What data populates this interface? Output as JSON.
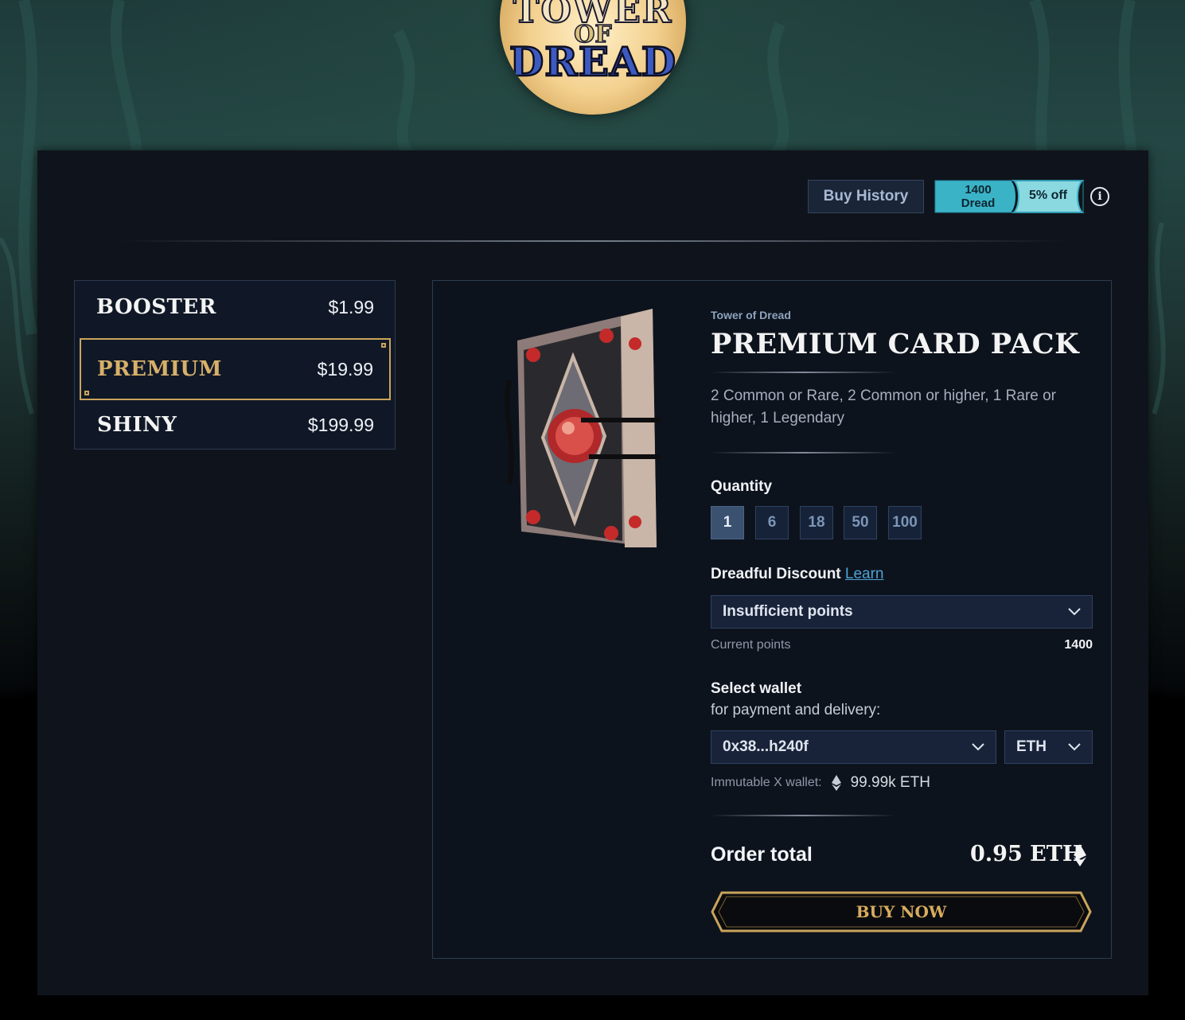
{
  "logo": {
    "line1": "TOWER",
    "line2": "OF",
    "line3": "DREAD"
  },
  "header": {
    "buy_history_label": "Buy History",
    "dread_points": "1400",
    "dread_unit": "Dread",
    "discount_label": "5% off",
    "info_icon": "i"
  },
  "packs": [
    {
      "name": "BOOSTER",
      "price": "$1.99",
      "selected": false
    },
    {
      "name": "PREMIUM",
      "price": "$19.99",
      "selected": true
    },
    {
      "name": "SHINY",
      "price": "$199.99",
      "selected": false
    }
  ],
  "product": {
    "brand": "Tower of Dread",
    "title": "PREMIUM CARD PACK",
    "description": "2 Common or Rare, 2 Common or higher, 1 Rare or higher, 1 Legendary",
    "image_icon": "card-pack-book-image"
  },
  "quantity": {
    "label": "Quantity",
    "options": [
      "1",
      "6",
      "18",
      "50",
      "100"
    ],
    "selected": "1"
  },
  "discount": {
    "label": "Dreadful Discount",
    "learn_label": "Learn",
    "select_value": "Insufficient points",
    "current_points_label": "Current points",
    "current_points_value": "1400"
  },
  "wallet": {
    "label": "Select wallet",
    "sublabel": "for payment and delivery:",
    "address": "0x38...h240f",
    "currency": "ETH",
    "balance_label": "Immutable X wallet:",
    "balance_value": "99.99k ETH"
  },
  "order": {
    "label": "Order total",
    "value": "0.95 ETH"
  },
  "buy_button_label": "BUY NOW",
  "colors": {
    "gold_accent": "#caa45c",
    "teal_badge": "#3ab3c7",
    "panel_bg": "#0f141c"
  }
}
